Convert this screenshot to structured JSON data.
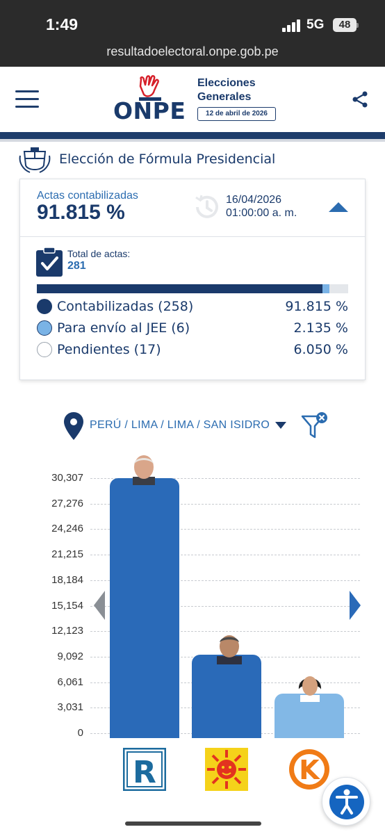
{
  "status_bar": {
    "time": "1:49",
    "network": "5G",
    "battery": "48",
    "url": "resultadoelectoral.onpe.gob.pe"
  },
  "header": {
    "logo_text": "ONPE",
    "title_line1": "Elecciones",
    "title_line2": "Generales",
    "date": "12 de abril de 2026"
  },
  "section_title": "Elección de Fórmula Presidencial",
  "summary": {
    "actas_label": "Actas contabilizadas",
    "actas_value": "91.815 %",
    "date": "16/04/2026",
    "time": "01:00:00 a. m.",
    "total_label": "Total de actas:",
    "total_value": "281",
    "progress": [
      {
        "fraction": 0.91815,
        "color": "#1a3a6b"
      },
      {
        "fraction": 0.02135,
        "color": "#7ab3e6"
      },
      {
        "fraction": 0.0605,
        "color": "#e4e7eb"
      }
    ],
    "legend": [
      {
        "label": "Contabilizadas (258)",
        "value": "91.815 %",
        "color": "#1a3a6b"
      },
      {
        "label": "Para envío al JEE (6)",
        "value": "2.135 %",
        "color": "#7ab3e6"
      },
      {
        "label": "Pendientes (17)",
        "value": "6.050 %",
        "color": "#ffffff"
      }
    ]
  },
  "filter": {
    "location": "PERÚ / LIMA / LIMA / SAN ISIDRO"
  },
  "chart_data": {
    "type": "bar",
    "ylim": [
      0,
      30307
    ],
    "y_ticks": [
      "30,307",
      "27,276",
      "24,246",
      "21,215",
      "18,184",
      "15,154",
      "12,123",
      "9,092",
      "6,061",
      "3,031",
      "0"
    ],
    "categories": [
      "R",
      "Sol",
      "K"
    ],
    "values": [
      30307,
      9300,
      4700
    ],
    "colors": [
      "#2a6ab8",
      "#2a6ab8",
      "#82b8e6"
    ]
  },
  "colors": {
    "brand": "#1a3a6b",
    "accent": "#2b6cb0"
  },
  "icons": [
    "menu-icon",
    "share-icon",
    "clock-icon",
    "chevron-up-icon",
    "checklist-icon",
    "location-pin-icon",
    "filter-clear-icon",
    "chevron-left-icon",
    "chevron-right-icon",
    "accessibility-icon"
  ]
}
